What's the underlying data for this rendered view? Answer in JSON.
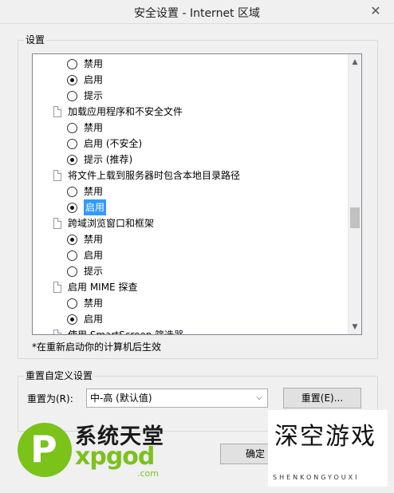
{
  "window": {
    "title": "安全设置 - Internet 区域",
    "close_glyph": "✕"
  },
  "settings": {
    "group_label": "设置",
    "items": [
      {
        "type": "radio",
        "label": "禁用",
        "checked": false
      },
      {
        "type": "radio",
        "label": "启用",
        "checked": true
      },
      {
        "type": "radio",
        "label": "提示",
        "checked": false
      },
      {
        "type": "header",
        "label": "加载应用程序和不安全文件"
      },
      {
        "type": "radio",
        "label": "禁用",
        "checked": false
      },
      {
        "type": "radio",
        "label": "启用 (不安全)",
        "checked": false
      },
      {
        "type": "radio",
        "label": "提示 (推荐)",
        "checked": true
      },
      {
        "type": "header",
        "label": "将文件上载到服务器时包含本地目录路径"
      },
      {
        "type": "radio",
        "label": "禁用",
        "checked": false
      },
      {
        "type": "radio",
        "label": "启用",
        "checked": true,
        "selected": true
      },
      {
        "type": "header",
        "label": "跨域浏览窗口和框架"
      },
      {
        "type": "radio",
        "label": "禁用",
        "checked": true
      },
      {
        "type": "radio",
        "label": "启用",
        "checked": false
      },
      {
        "type": "radio",
        "label": "提示",
        "checked": false
      },
      {
        "type": "header",
        "label": "启用 MIME 探查"
      },
      {
        "type": "radio",
        "label": "禁用",
        "checked": false
      },
      {
        "type": "radio",
        "label": "启用",
        "checked": true
      },
      {
        "type": "header",
        "label": "使用 SmartScreen 筛选器"
      }
    ],
    "scroll_up_glyph": "▲",
    "scroll_down_glyph": "▼"
  },
  "note": "*在重新启动你的计算机后生效",
  "reset": {
    "group_label": "重置自定义设置",
    "reset_to_label": "重置为(R):",
    "level_value": "中-高 (默认值)",
    "reset_button": "重置(E)..."
  },
  "footer": {
    "ok_button": "确定"
  },
  "watermark_left": {
    "cn": "系统天堂",
    "en": "xpgod",
    "com": ".com",
    "logo_letter": "P"
  },
  "watermark_right": {
    "cn": "深空游戏",
    "en": "SHENKONGYOUXI"
  },
  "colors": {
    "selection": "#3399ff",
    "brand_green": "#7bc21b"
  }
}
